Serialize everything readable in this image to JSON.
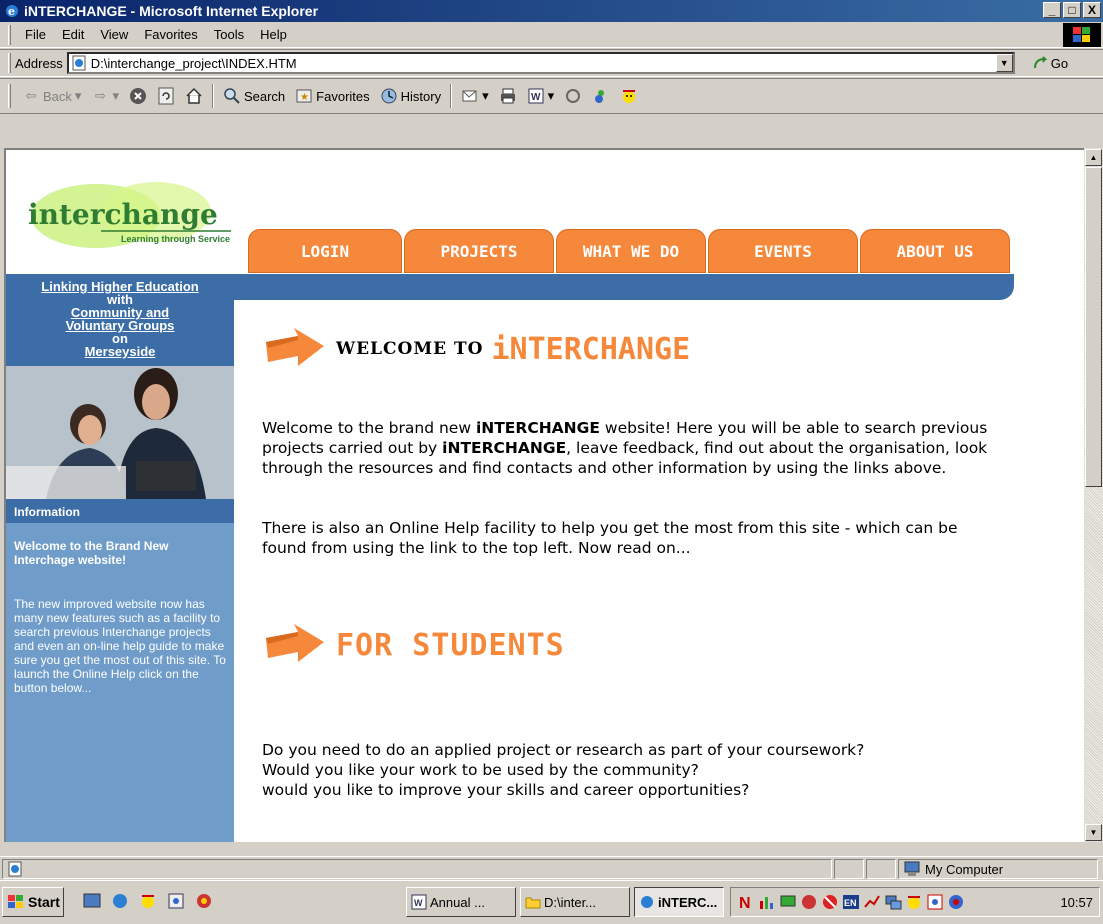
{
  "window": {
    "title": "iNTERCHANGE - Microsoft Internet Explorer",
    "min": "_",
    "max": "□",
    "close": "X"
  },
  "menu": [
    "File",
    "Edit",
    "View",
    "Favorites",
    "Tools",
    "Help"
  ],
  "address": {
    "label": "Address",
    "url": "D:\\interchange_project\\INDEX.HTM",
    "go_label": "Go"
  },
  "toolbar": {
    "back": "Back",
    "search": "Search",
    "favorites": "Favorites",
    "history": "History"
  },
  "page": {
    "logo_text": "interchange",
    "logo_tagline": "Learning through Service",
    "nav": [
      "LOGIN",
      "PROJECTS",
      "WHAT WE DO",
      "EVENTS",
      "ABOUT US"
    ],
    "sidebar": {
      "link1": "Linking Higher Education",
      "plain1": "with",
      "link2": "Community and",
      "link3": "Voluntary Groups",
      "plain2": "on",
      "link4": "Merseyside",
      "info_label": "Information",
      "welcome": "Welcome to the Brand New Interchage website!",
      "body": "The new improved website now has many new features such as a facility to search previous Interchange projects and even an on-line help guide to make sure you get the most out of this site. To launch the Online Help click on the button below..."
    },
    "welcome_pre": "WELCOME TO",
    "welcome_brand": "iNTERCHANGE",
    "para1_a": "Welcome to the brand new ",
    "para1_b": "iNTERCHANGE",
    "para1_c": " website! Here you will be able to search previous projects carried out by ",
    "para1_d": "iNTERCHANGE",
    "para1_e": ", leave feedback, find out about the organisation, look through the resources and find contacts and other information by using the links above.",
    "para2": "There is also an Online Help facility to help you get the most from this site - which can be found from using the link to the top left. Now read on...",
    "students_title": "FOR STUDENTS",
    "students_q1": "Do you need to do an applied project or research as part of your coursework?",
    "students_q2": "Would you like your work to be used by the community?",
    "students_q3": "would you like to improve your skills and career opportunities?"
  },
  "status": {
    "zone": "My Computer"
  },
  "taskbar": {
    "start": "Start",
    "tasks": [
      "Annual ...",
      "D:\\inter...",
      "iNTERC..."
    ],
    "clock": "10:57"
  }
}
